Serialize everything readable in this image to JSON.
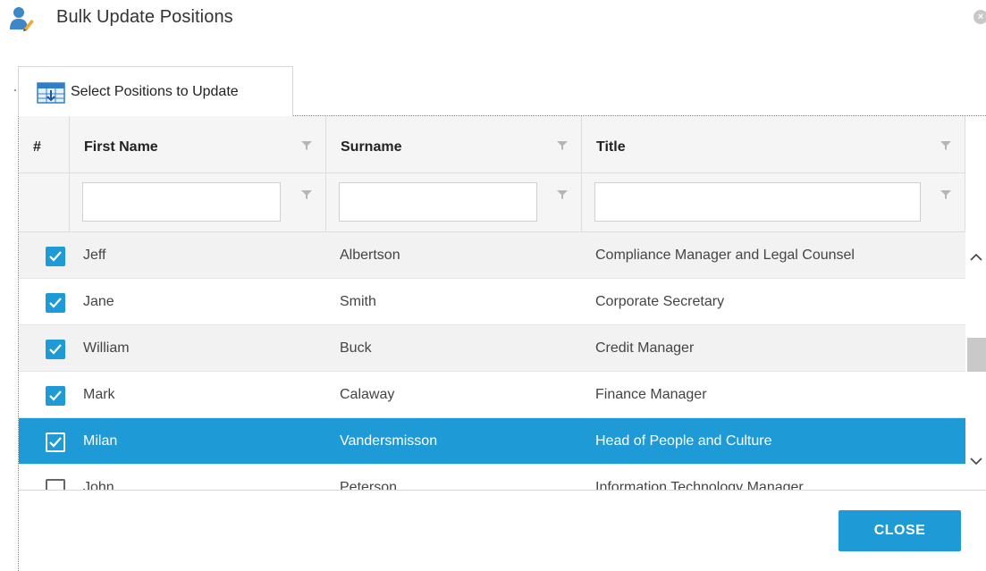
{
  "dialog": {
    "title": "Bulk Update Positions",
    "close_icon": "close-icon"
  },
  "tab": {
    "label": "Select Positions to Update",
    "icon": "table-icon"
  },
  "grid": {
    "columns": [
      {
        "key": "select",
        "label": "#"
      },
      {
        "key": "first_name",
        "label": "First Name"
      },
      {
        "key": "surname",
        "label": "Surname"
      },
      {
        "key": "title",
        "label": "Title"
      }
    ],
    "filters": {
      "first_name": "",
      "surname": "",
      "title": ""
    },
    "rows": [
      {
        "checked": true,
        "first_name": "Jeff",
        "surname": "Albertson",
        "title": "Compliance Manager and Legal Counsel",
        "selected": false
      },
      {
        "checked": true,
        "first_name": "Jane",
        "surname": "Smith",
        "title": "Corporate Secretary",
        "selected": false
      },
      {
        "checked": true,
        "first_name": "William",
        "surname": "Buck",
        "title": "Credit Manager",
        "selected": false
      },
      {
        "checked": true,
        "first_name": "Mark",
        "surname": "Calaway",
        "title": "Finance Manager",
        "selected": false
      },
      {
        "checked": true,
        "first_name": "Milan",
        "surname": "Vandersmisson",
        "title": "Head of People and Culture",
        "selected": true
      },
      {
        "checked": false,
        "first_name": "John",
        "surname": "Peterson",
        "title": "Information Technology Manager",
        "selected": false
      }
    ]
  },
  "footer": {
    "close_label": "CLOSE"
  },
  "colors": {
    "accent": "#1e9ad6",
    "header_bg": "#f5f5f5",
    "row_bg": "#f2f2f2"
  }
}
